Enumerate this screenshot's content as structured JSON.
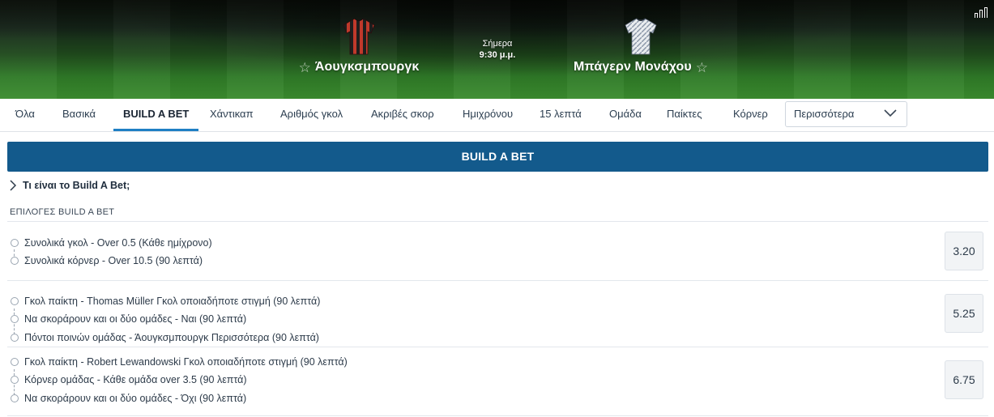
{
  "match": {
    "home_team": "Άουγκσμπουργκ",
    "away_team": "Μπάγερν Μονάχου",
    "day": "Σήμερα",
    "time": "9:30 μ.μ.",
    "home_kit_colors": [
      "#c0392b",
      "#1e1e1e"
    ],
    "away_kit_colors": [
      "#e9ecef",
      "#8a96a8"
    ]
  },
  "tabs": [
    {
      "label": "Όλα",
      "active": false
    },
    {
      "label": "Βασικά",
      "active": false
    },
    {
      "label": "BUILD A BET",
      "active": true
    },
    {
      "label": "Χάντικαπ",
      "active": false
    },
    {
      "label": "Αριθμός γκολ",
      "active": false
    },
    {
      "label": "Ακριβές σκορ",
      "active": false
    },
    {
      "label": "Ημιχρόνου",
      "active": false
    },
    {
      "label": "15 λεπτά",
      "active": false
    },
    {
      "label": "Ομάδα",
      "active": false
    },
    {
      "label": "Παίκτες",
      "active": false
    },
    {
      "label": "Κόρνερ",
      "active": false
    }
  ],
  "more_dropdown": {
    "selected": "Περισσότερα"
  },
  "build_a_bet": {
    "header": "BUILD A BET",
    "info_toggle": "Τι είναι το Build A Bet;",
    "section_title": "ΕΠΙΛΟΓΕΣ BUILD A BET",
    "bets": [
      {
        "selections": [
          "Συνολικά γκολ - Over 0.5 (Κάθε ημίχρονο)",
          "Συνολικά κόρνερ - Over 10.5 (90 λεπτά)"
        ],
        "odds": "3.20"
      },
      {
        "selections": [
          "Γκολ παίκτη - Thomas Müller Γκολ οποιαδήποτε στιγμή (90 λεπτά)",
          "Να σκοράρουν και οι δύο ομάδες - Ναι (90 λεπτά)",
          "Πόντοι ποινών ομάδας - Άουγκσμπουργκ Περισσότερα (90 λεπτά)"
        ],
        "odds": "5.25"
      },
      {
        "selections": [
          "Γκολ παίκτη - Robert Lewandowski Γκολ οποιαδήποτε στιγμή (90 λεπτά)",
          "Κόρνερ ομάδας - Κάθε ομάδα over 3.5 (90 λεπτά)",
          "Να σκοράρουν και οι δύο ομάδες - Όχι (90 λεπτά)"
        ],
        "odds": "6.75"
      }
    ]
  },
  "colors": {
    "accent_blue": "#135a8c",
    "tab_underline": "#1f7fc4"
  }
}
